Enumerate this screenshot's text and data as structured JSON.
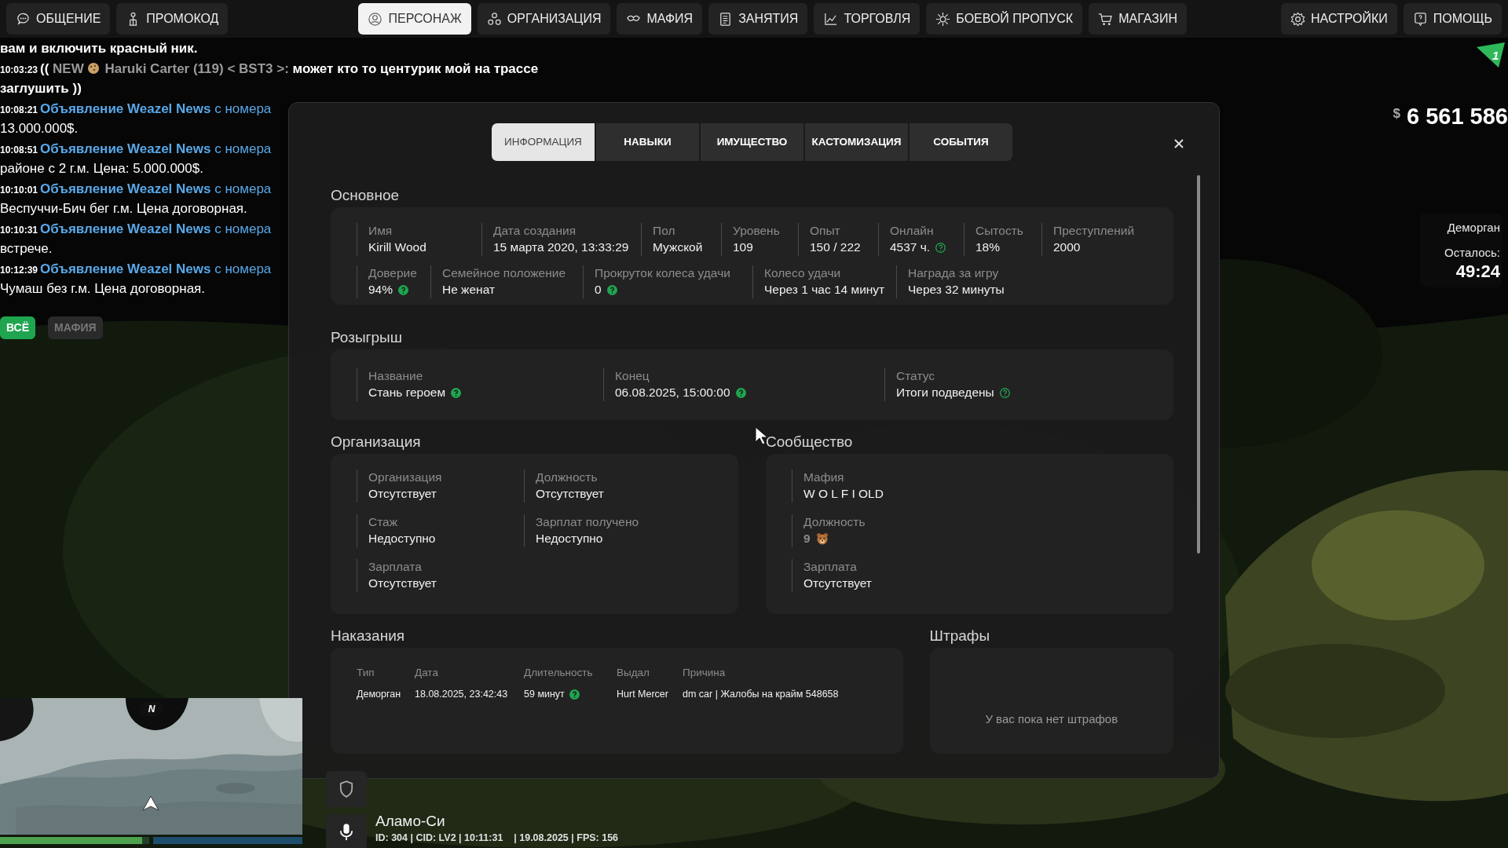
{
  "nav": {
    "left": [
      {
        "label": "ОБЩЕНИЕ",
        "selected": false
      },
      {
        "label": "ПРОМОКОД",
        "selected": false
      },
      {
        "label": "ПЕРСОНАЖ",
        "selected": true
      },
      {
        "label": "ОРГАНИЗАЦИЯ",
        "selected": false
      },
      {
        "label": "МАФИЯ",
        "selected": false
      },
      {
        "label": "ЗАНЯТИЯ",
        "selected": false
      },
      {
        "label": "ТОРГОВЛЯ",
        "selected": false
      },
      {
        "label": "БОЕВОЙ ПРОПУСК",
        "selected": false
      },
      {
        "label": "МАГАЗИН",
        "selected": false
      }
    ],
    "right": [
      {
        "label": "НАСТРОЙКИ",
        "selected": false
      },
      {
        "label": "ПОМОЩЬ",
        "selected": false
      }
    ]
  },
  "chat": {
    "lines": [
      {
        "kind": "system",
        "text": "вам и включить красный ник."
      },
      {
        "kind": "player",
        "time": "10:03:23",
        "prefix": "((",
        "tag": "NEW",
        "author": "Haruki Carter (119) < BST3 >:",
        "text": "может кто то центурик мой на трассе заглушить ))"
      },
      {
        "kind": "ad",
        "time": "10:08:21",
        "source": "Объявление Weazel News",
        "via": "с номера",
        "text": "13.000.000$."
      },
      {
        "kind": "ad",
        "time": "10:08:51",
        "source": "Объявление Weazel News",
        "via": "с номера",
        "text": "районе с 2 г.м. Цена: 5.000.000$."
      },
      {
        "kind": "ad",
        "time": "10:10:01",
        "source": "Объявление Weazel News",
        "via": "с номера",
        "text": "Веспуччи-Бич бег г.м. Цена договорная."
      },
      {
        "kind": "ad",
        "time": "10:10:31",
        "source": "Объявление Weazel News",
        "via": "с номера",
        "text": "встрече."
      },
      {
        "kind": "ad",
        "time": "10:12:39",
        "source": "Объявление Weazel News",
        "via": "с номера",
        "text": "Чумаш без г.м. Цена договорная."
      }
    ],
    "filters": [
      {
        "label": "ВСЁ",
        "selected": true
      },
      {
        "label": "МАФИЯ",
        "selected": false
      }
    ]
  },
  "character_window": {
    "tabs": [
      {
        "label": "ИНФОРМАЦИЯ",
        "selected": true
      },
      {
        "label": "НАВЫКИ",
        "selected": false
      },
      {
        "label": "ИМУЩЕСТВО",
        "selected": false
      },
      {
        "label": "КАСТОМИЗАЦИЯ",
        "selected": false
      },
      {
        "label": "СОБЫТИЯ",
        "selected": false
      }
    ],
    "basic": {
      "title": "Основное",
      "lines": [
        {
          "fields": [
            {
              "label": "Имя",
              "value": "Kirill Wood"
            },
            {
              "label": "Дата создания",
              "value": "15 марта 2020, 13:33:29"
            },
            {
              "label": "Пол",
              "value": "Мужской"
            },
            {
              "label": "Уровень",
              "value": "109"
            },
            {
              "label": "Опыт",
              "value": "150 / 222"
            },
            {
              "label": "Онлайн",
              "value": "4537 ч.",
              "hint": true,
              "hint_outline": true
            },
            {
              "label": "Сытость",
              "value": "18%"
            },
            {
              "label": "Преступлений",
              "value": "2000"
            }
          ]
        },
        {
          "fields": [
            {
              "label": "Доверие",
              "value": "94%",
              "hint": true,
              "hint_outline": false
            },
            {
              "label": "Семейное положение",
              "value": "Не женат"
            },
            {
              "label": "Прокруток колеса удачи",
              "value": "0",
              "hint": true,
              "hint_outline": false
            },
            {
              "label": "Колесо удачи",
              "value": "Через 1 час 14 минут"
            },
            {
              "label": "Награда за игру",
              "value": "Через 32 минуты"
            }
          ]
        }
      ]
    },
    "raffle": {
      "title": "Розыгрыш",
      "fields": [
        {
          "label": "Название",
          "value": "Стань героем",
          "hint": true,
          "hint_outline": false
        },
        {
          "label": "Конец",
          "value": "06.08.2025, 15:00:00",
          "hint": true,
          "hint_outline": false
        },
        {
          "label": "Статус",
          "value": "Итоги подведены",
          "hint": true,
          "hint_outline": true
        }
      ]
    },
    "organization": {
      "title": "Организация",
      "fields": [
        {
          "label": "Организация",
          "value": "Отсутствует"
        },
        {
          "label": "Должность",
          "value": "Отсутствует"
        },
        {
          "label": "Стаж",
          "value": "Недоступно"
        },
        {
          "label": "Зарплат получено",
          "value": "Недоступно"
        },
        {
          "label": "Зарплата",
          "value": "Отсутствует"
        }
      ]
    },
    "community": {
      "title": "Сообщество",
      "fields": [
        {
          "label": "Мафия",
          "value": "W O L F I OLD",
          "kind": "text"
        },
        {
          "label": "Должность",
          "value": "9",
          "kind": "rank"
        },
        {
          "label": "Зарплата",
          "value": "Отсутствует",
          "kind": "text"
        }
      ]
    },
    "punishments": {
      "title": "Наказания",
      "columns": [
        "Тип",
        "Дата",
        "Длительность",
        "Выдал",
        "Причина"
      ],
      "rows": [
        {
          "cells": [
            "Деморган",
            "18.08.2025, 23:42:43",
            "59 минут",
            "Hurt Mercer",
            "dm car | Жалобы на крайм 548658"
          ],
          "hint": true,
          "hint_outline": false
        }
      ]
    },
    "fines": {
      "title": "Штрафы",
      "empty": "У вас пока нет штрафов"
    }
  },
  "hud": {
    "badge": "1",
    "currency": "$",
    "money": "6 561 586",
    "jail": {
      "place": "Деморган",
      "remaining_label": "Осталось:",
      "remaining": "49:24"
    }
  },
  "minimap": {
    "compass": "N",
    "health": {
      "level": 0.95
    },
    "armor": {
      "level": 1
    }
  },
  "location": {
    "area": "Аламо-Си",
    "info": "ID: 304 | CID: LV2 | 10:11:31    | 19.08.2025 | FPS: 156"
  }
}
